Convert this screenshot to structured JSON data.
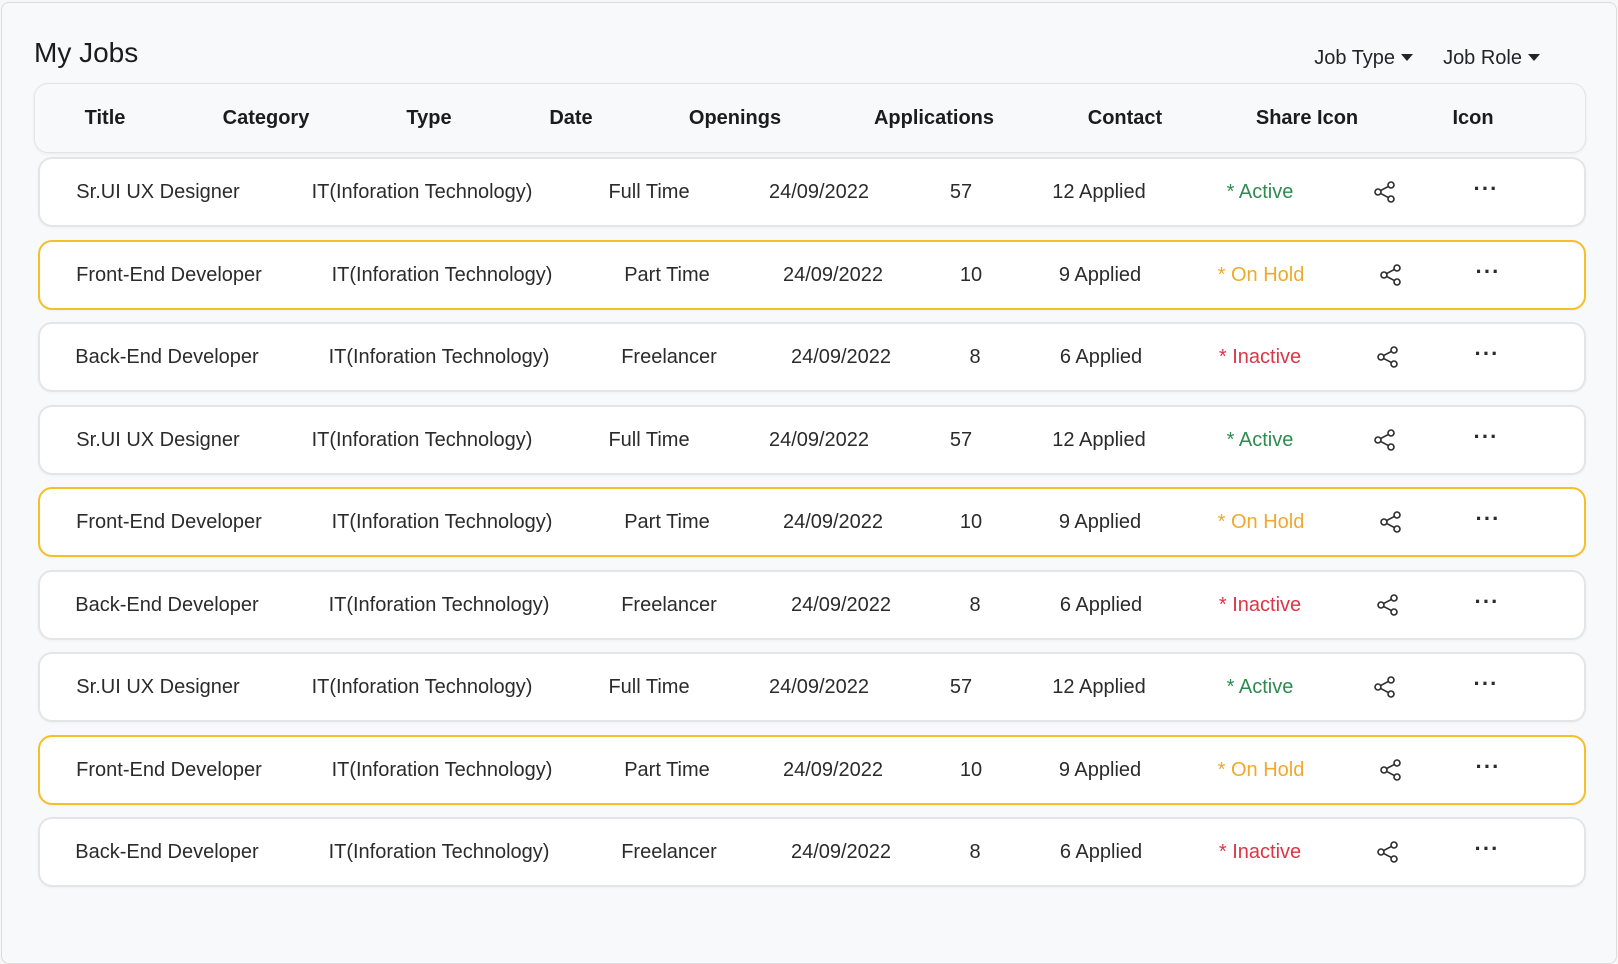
{
  "page": {
    "title": "My Jobs"
  },
  "filters": {
    "job_type": "Job Type",
    "job_role": "Job Role"
  },
  "columns": [
    "Title",
    "Category",
    "Type",
    "Date",
    "Openings",
    "Applications",
    "Contact",
    "Share Icon",
    "Icon"
  ],
  "colors": {
    "active": "#2e8b4f",
    "on_hold": "#f0a92c",
    "inactive": "#dc3545",
    "hold_border": "#f5c027"
  },
  "rows": [
    {
      "title": "Sr.UI UX Designer",
      "category": "IT(Inforation Technology)",
      "type": "Full Time",
      "date": "24/09/2022",
      "openings": "57",
      "applications": "12 Applied",
      "status": "* Active",
      "status_kind": "active",
      "share_icon": "share-icon",
      "more_icon": "more-horizontal-icon"
    },
    {
      "title": "Front-End Developer",
      "category": "IT(Inforation Technology)",
      "type": "Part Time",
      "date": "24/09/2022",
      "openings": "10",
      "applications": "9 Applied",
      "status": "* On Hold",
      "status_kind": "hold",
      "share_icon": "share-icon",
      "more_icon": "more-horizontal-icon"
    },
    {
      "title": "Back-End Developer",
      "category": "IT(Inforation Technology)",
      "type": "Freelancer",
      "date": "24/09/2022",
      "openings": "8",
      "applications": "6 Applied",
      "status": "* Inactive",
      "status_kind": "inactive",
      "share_icon": "share-icon",
      "more_icon": "more-horizontal-icon"
    },
    {
      "title": "Sr.UI UX Designer",
      "category": "IT(Inforation Technology)",
      "type": "Full Time",
      "date": "24/09/2022",
      "openings": "57",
      "applications": "12 Applied",
      "status": "* Active",
      "status_kind": "active",
      "share_icon": "share-icon",
      "more_icon": "more-horizontal-icon"
    },
    {
      "title": "Front-End Developer",
      "category": "IT(Inforation Technology)",
      "type": "Part Time",
      "date": "24/09/2022",
      "openings": "10",
      "applications": "9 Applied",
      "status": "* On Hold",
      "status_kind": "hold",
      "share_icon": "share-icon",
      "more_icon": "more-horizontal-icon"
    },
    {
      "title": "Back-End Developer",
      "category": "IT(Inforation Technology)",
      "type": "Freelancer",
      "date": "24/09/2022",
      "openings": "8",
      "applications": "6 Applied",
      "status": "* Inactive",
      "status_kind": "inactive",
      "share_icon": "share-icon",
      "more_icon": "more-horizontal-icon"
    },
    {
      "title": "Sr.UI UX Designer",
      "category": "IT(Inforation Technology)",
      "type": "Full Time",
      "date": "24/09/2022",
      "openings": "57",
      "applications": "12 Applied",
      "status": "* Active",
      "status_kind": "active",
      "share_icon": "share-icon",
      "more_icon": "more-horizontal-icon"
    },
    {
      "title": "Front-End Developer",
      "category": "IT(Inforation Technology)",
      "type": "Part Time",
      "date": "24/09/2022",
      "openings": "10",
      "applications": "9 Applied",
      "status": "* On Hold",
      "status_kind": "hold",
      "share_icon": "share-icon",
      "more_icon": "more-horizontal-icon"
    },
    {
      "title": "Back-End Developer",
      "category": "IT(Inforation Technology)",
      "type": "Freelancer",
      "date": "24/09/2022",
      "openings": "8",
      "applications": "6 Applied",
      "status": "* Inactive",
      "status_kind": "inactive",
      "share_icon": "share-icon",
      "more_icon": "more-horizontal-icon"
    }
  ]
}
